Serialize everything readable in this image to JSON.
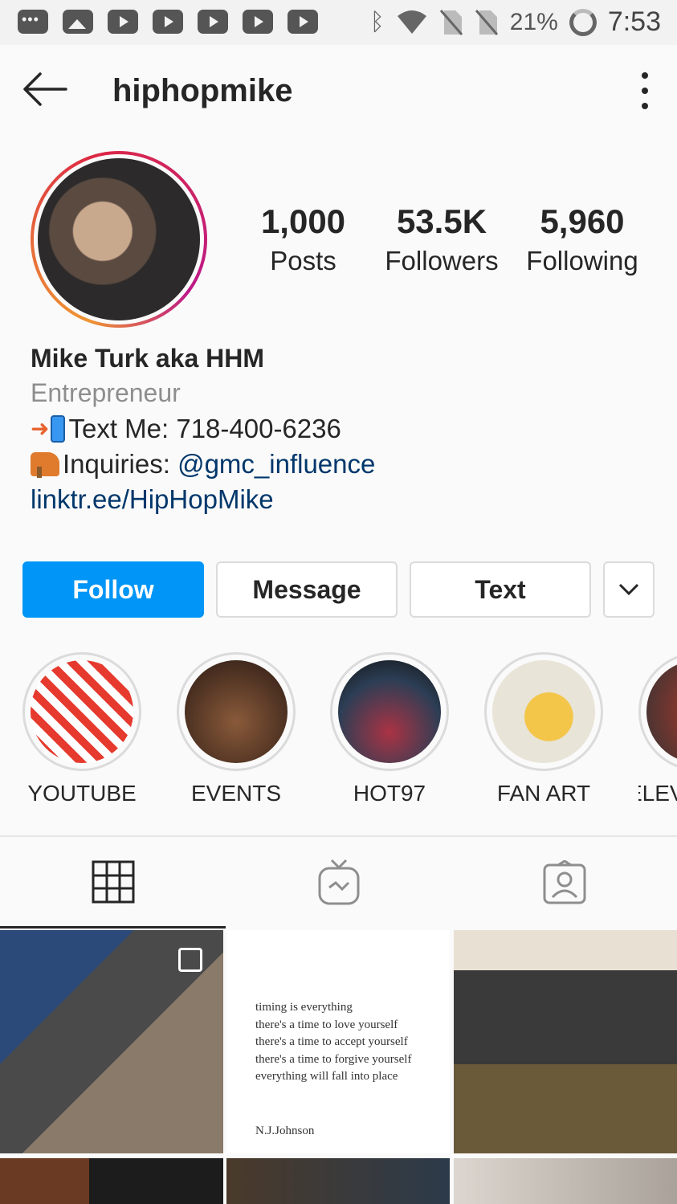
{
  "status_bar": {
    "battery": "21%",
    "time": "7:53",
    "icons": [
      "chat-icon",
      "image-icon",
      "youtube-icon",
      "youtube-icon",
      "youtube-icon",
      "youtube-icon",
      "youtube-icon",
      "bluetooth-icon",
      "wifi-icon",
      "no-sim-icon",
      "no-sim-icon",
      "battery-ring-icon"
    ]
  },
  "header": {
    "username": "hiphopmike",
    "icons": [
      "back-arrow-icon",
      "more-vertical-icon"
    ]
  },
  "profile": {
    "stats": [
      {
        "value": "1,000",
        "label": "Posts"
      },
      {
        "value": "53.5K",
        "label": "Followers"
      },
      {
        "value": "5,960",
        "label": "Following"
      }
    ],
    "name": "Mike Turk aka HHM",
    "category": "Entrepreneur",
    "bio_text_label": "Text Me: 718-400-6236",
    "bio_inquiries_label": "Inquiries: ",
    "bio_inquiries_handle": "@gmc_influence",
    "bio_link": "linktr.ee/HipHopMike"
  },
  "actions": {
    "follow": "Follow",
    "message": "Message",
    "text": "Text"
  },
  "highlights": [
    {
      "label": "YOUTUBE",
      "color": "#e63a2e"
    },
    {
      "label": "EVENTS",
      "color": "#6a3a2a"
    },
    {
      "label": "HOT97",
      "color": "#2c3e55"
    },
    {
      "label": "FAN ART",
      "color": "#f3c64a"
    },
    {
      "label": "ELEV/",
      "color": "#c0392b"
    }
  ],
  "tabs": [
    "grid-tab",
    "igtv-tab",
    "tagged-tab"
  ],
  "posts": {
    "quote_lines": [
      "timing is everything",
      "there's a time to love yourself",
      "there's a time to accept yourself",
      "there's a time to forgive yourself",
      "everything will fall into place"
    ],
    "quote_author": "N.J.Johnson"
  },
  "colors": {
    "accent": "#0095f6",
    "link": "#00376b",
    "muted": "#8e8e8e"
  }
}
